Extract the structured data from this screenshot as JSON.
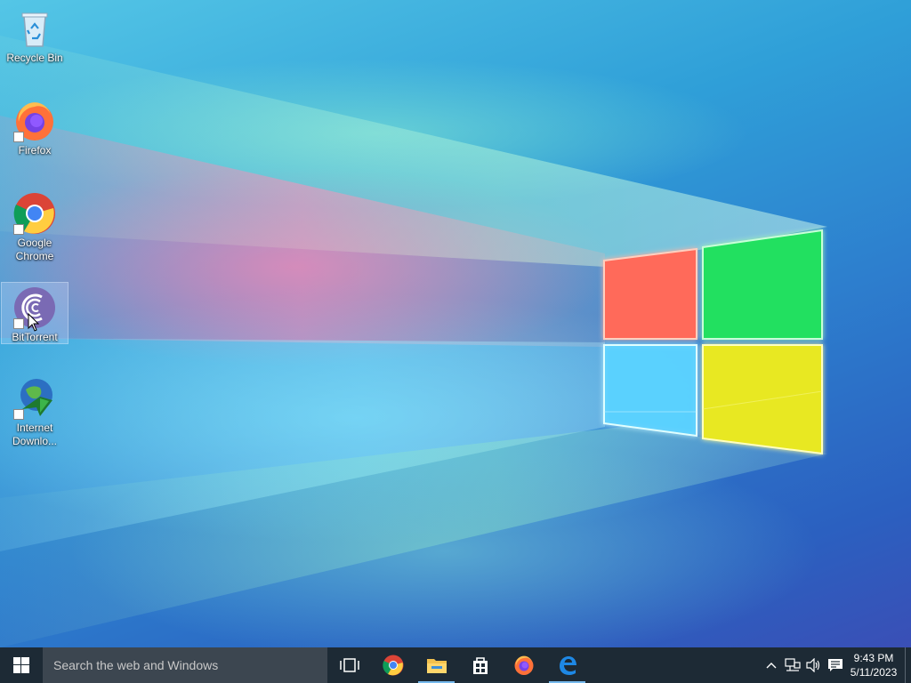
{
  "desktop": {
    "icons": [
      {
        "label": "Recycle Bin"
      },
      {
        "label": "Firefox"
      },
      {
        "label": "Google Chrome"
      },
      {
        "label": "BitTorrent"
      },
      {
        "label": "Internet Downlo..."
      }
    ]
  },
  "taskbar": {
    "search_placeholder": "Search the web and Windows",
    "pinned": [
      "task-view",
      "google-chrome",
      "file-explorer",
      "store",
      "firefox",
      "edge"
    ]
  },
  "tray": {
    "time": "9:43 PM",
    "date": "5/11/2023"
  },
  "colors": {
    "taskbar": "#1d2a35",
    "search": "#3c4650",
    "running_indicator": "#76b9ed",
    "logo_red": "#ff6b5a",
    "logo_green": "#20e060",
    "logo_blue": "#5ad2ff",
    "logo_yellow": "#e8e820"
  }
}
